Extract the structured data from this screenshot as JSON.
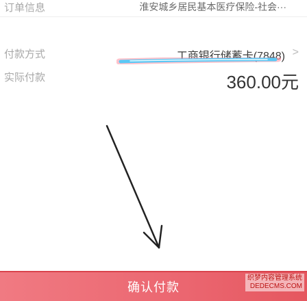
{
  "order": {
    "label": "订单信息",
    "value": "淮安城乡居民基本医疗保险-社会···"
  },
  "payment_method": {
    "label": "付款方式",
    "value": "工商银行储蓄卡(7848)",
    "chevron": ">"
  },
  "amount": {
    "label": "实际付款",
    "value": "360.00元"
  },
  "confirm": {
    "label": "确认付款"
  },
  "watermark": {
    "line1": "织梦内容管理系统",
    "line2": "DEDECMS.COM"
  },
  "colors": {
    "accent": "#eb6670",
    "arrow": "#222222",
    "highlight": "#4fc3f7",
    "highlight_glow": "#ff7b8c"
  },
  "icons": {
    "chevron": "chevron-right-icon"
  }
}
